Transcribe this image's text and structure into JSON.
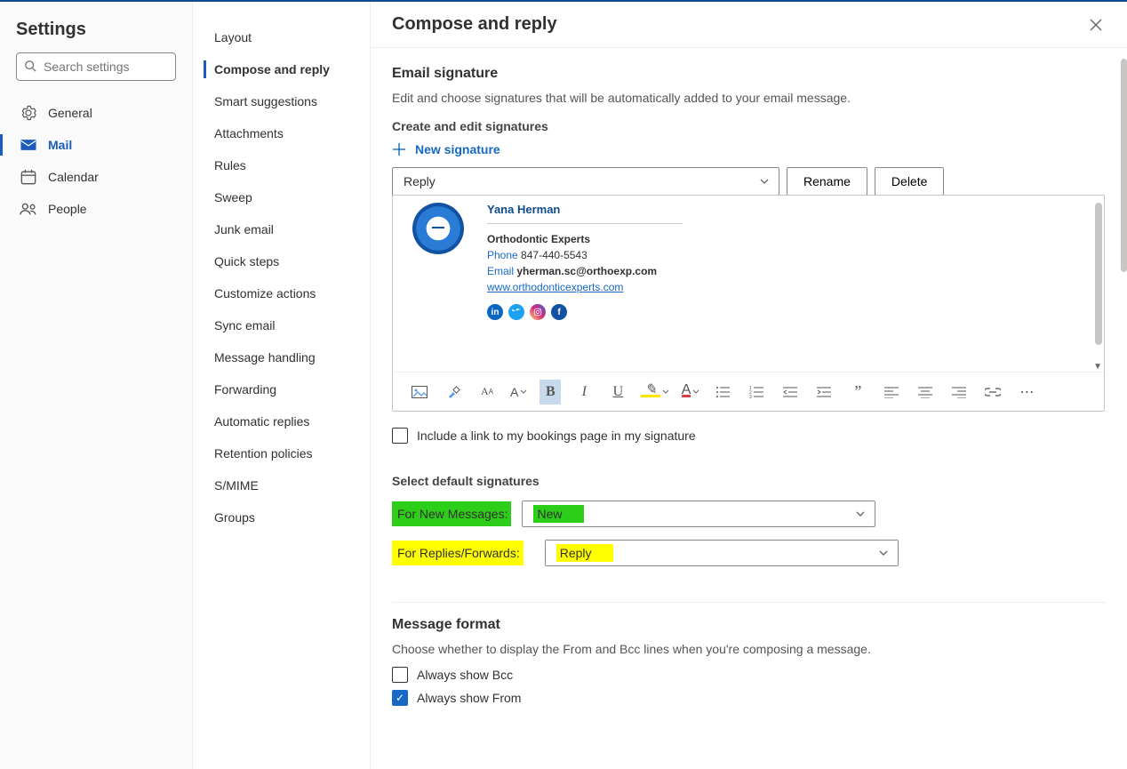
{
  "title": "Settings",
  "search_placeholder": "Search settings",
  "nav_primary": [
    {
      "key": "general",
      "icon": "gear",
      "label": "General"
    },
    {
      "key": "mail",
      "icon": "mail",
      "label": "Mail",
      "active": true
    },
    {
      "key": "calendar",
      "icon": "calendar",
      "label": "Calendar"
    },
    {
      "key": "people",
      "icon": "people",
      "label": "People"
    }
  ],
  "nav_mail": [
    {
      "key": "layout",
      "label": "Layout"
    },
    {
      "key": "compose",
      "label": "Compose and reply",
      "active": true
    },
    {
      "key": "smart",
      "label": "Smart suggestions"
    },
    {
      "key": "attach",
      "label": "Attachments"
    },
    {
      "key": "rules",
      "label": "Rules"
    },
    {
      "key": "sweep",
      "label": "Sweep"
    },
    {
      "key": "junk",
      "label": "Junk email"
    },
    {
      "key": "quick",
      "label": "Quick steps"
    },
    {
      "key": "custom",
      "label": "Customize actions"
    },
    {
      "key": "sync",
      "label": "Sync email"
    },
    {
      "key": "msgh",
      "label": "Message handling"
    },
    {
      "key": "fwd",
      "label": "Forwarding"
    },
    {
      "key": "auto",
      "label": "Automatic replies"
    },
    {
      "key": "ret",
      "label": "Retention policies"
    },
    {
      "key": "smime",
      "label": "S/MIME"
    },
    {
      "key": "groups",
      "label": "Groups"
    }
  ],
  "page": {
    "title": "Compose and reply"
  },
  "emailSignature": {
    "heading": "Email signature",
    "desc": "Edit and choose signatures that will be automatically added to your email message.",
    "createLabel": "Create and edit signatures",
    "newLabel": "New signature",
    "selected": "Reply",
    "renameLabel": "Rename",
    "deleteLabel": "Delete",
    "preview": {
      "name": "Yana Herman",
      "company": "Orthodontic Experts",
      "phoneLabel": "Phone",
      "phone": "847-440-5543",
      "emailLabel": "Email",
      "email": "yherman.sc@orthoexp.com",
      "url": "www.orthodonticexperts.com"
    },
    "bookingsLabel": "Include a link to my bookings page in my signature"
  },
  "defaults": {
    "heading": "Select default signatures",
    "newLabel": "For New Messages:",
    "newValue": "New",
    "replyLabel": "For Replies/Forwards:",
    "replyValue": "Reply"
  },
  "messageFormat": {
    "heading": "Message format",
    "desc": "Choose whether to display the From and Bcc lines when you're composing a message.",
    "bccLabel": "Always show Bcc",
    "bccChecked": false,
    "fromLabel": "Always show From",
    "fromChecked": true
  }
}
